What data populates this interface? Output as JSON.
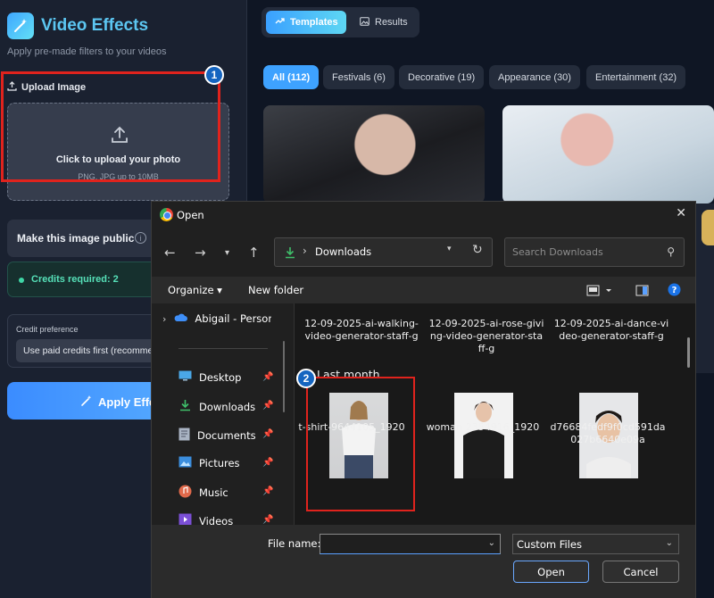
{
  "app": {
    "title": "Video Effects",
    "subtitle": "Apply pre-made filters to your videos",
    "accent": "#5cc7f2"
  },
  "upload": {
    "label": "Upload Image",
    "dropzone_title": "Click to upload your photo",
    "dropzone_hint": "PNG, JPG up to 10MB"
  },
  "public_toggle": {
    "label": "Make this image public",
    "info_icon": "info-icon"
  },
  "credits": {
    "text": "Credits required: 2",
    "color": "#56e0b8"
  },
  "credit_preference": {
    "label": "Credit preference",
    "selected": "Use paid credits first (recommended)"
  },
  "apply_button": {
    "label": "Apply Effects"
  },
  "annotations": {
    "step1": "1",
    "step2": "2",
    "highlight_color": "#e0231d"
  },
  "top_tabs": [
    {
      "label": "Templates",
      "active": true,
      "icon": "trending-icon"
    },
    {
      "label": "Results",
      "active": false,
      "icon": "image-icon"
    }
  ],
  "categories": [
    {
      "label": "All (112)",
      "active": true
    },
    {
      "label": "Festivals (6)",
      "active": false
    },
    {
      "label": "Decorative (19)",
      "active": false
    },
    {
      "label": "Appearance (30)",
      "active": false
    },
    {
      "label": "Entertainment (32)",
      "active": false
    }
  ],
  "dialog": {
    "title": "Open",
    "path": "Downloads",
    "search_placeholder": "Search Downloads",
    "toolbar": {
      "organize": "Organize",
      "new_folder": "New folder"
    },
    "nav": [
      {
        "label": "Abigail - Personal",
        "icon": "onedrive-cloud-icon",
        "pinned": false
      },
      {
        "label": "Desktop",
        "icon": "desktop-icon",
        "pinned": true
      },
      {
        "label": "Downloads",
        "icon": "download-icon",
        "pinned": true
      },
      {
        "label": "Documents",
        "icon": "documents-icon",
        "pinned": true
      },
      {
        "label": "Pictures",
        "icon": "pictures-icon",
        "pinned": true
      },
      {
        "label": "Music",
        "icon": "music-icon",
        "pinned": true
      },
      {
        "label": "Videos",
        "icon": "videos-icon",
        "pinned": true
      }
    ],
    "files_top": [
      "12-09-2025-ai-walking-video-generator-staff-g",
      "12-09-2025-ai-rose-giving-video-generator-staff-g",
      "12-09-2025-ai-dance-video-generator-staff-g"
    ],
    "section_label": "Last month",
    "files": [
      {
        "name": "t-shirt-9644105_1920"
      },
      {
        "name": "woman-2354916_1920"
      },
      {
        "name": "d76684fedf9f0cd591da027b6640e09a"
      }
    ],
    "file_name_label": "File name:",
    "file_name_value": "",
    "file_type": "Custom Files",
    "open_label": "Open",
    "cancel_label": "Cancel"
  }
}
